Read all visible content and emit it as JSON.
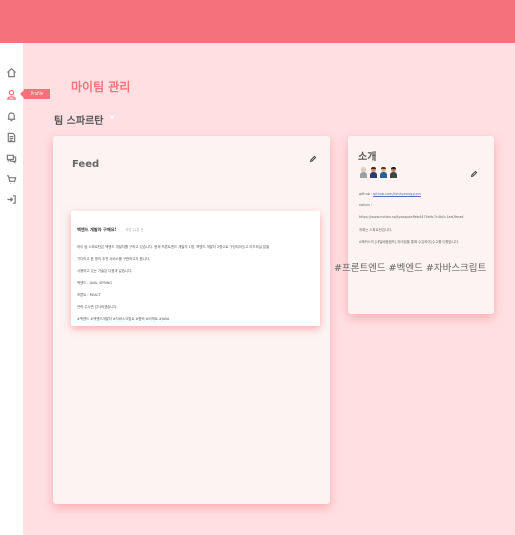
{
  "colors": {
    "accent": "#f6727b",
    "background": "#ffdfe2",
    "card": "#fdf3f3"
  },
  "sidebar": {
    "items": [
      {
        "icon": "home-icon"
      },
      {
        "icon": "user-icon",
        "tooltip": "Profile"
      },
      {
        "icon": "bell-icon"
      },
      {
        "icon": "document-icon"
      },
      {
        "icon": "chat-icon"
      },
      {
        "icon": "cart-icon"
      },
      {
        "icon": "logout-icon"
      }
    ]
  },
  "page": {
    "title": "마이팀 관리"
  },
  "team": {
    "name": "팀 스파르탄"
  },
  "feed": {
    "label": "Feed",
    "post": {
      "title": "백엔드 개발자 구해요!",
      "meta": "작성 12분 전",
      "lines": [
        "하이 팀 스파르탄은 백엔드 개발자를 구하고 있습니다. 현재 프론트엔드 개발자 1명, 백엔드 개발자 2명으로 구성되어있고 리드하실 분을",
        "기다리고 한 명의 추천 서비스를 구현하고자 합니다.",
        "사용하고 있는 기술은 다음과 같습니다.",
        "백엔드 : JAVA, SPRING",
        "프론트 : REACT",
        "연락 주시면 감사하겠습니다",
        "#백엔드 #백엔드개발자 #자바스크립트 #협력 #리액트 #JAVA"
      ]
    }
  },
  "intro": {
    "title": "소개",
    "github_prefix": "github : ",
    "github_link": "github.com/kimhyeongyunn",
    "notion_label": "notion :",
    "notion_url": "https://www.notion.so/tysoopaeffeb4474a9c7c4b0c1aa0fmad",
    "line1": "저희는 스파르탄입니다.",
    "line2": "A해커스의 [내일배움캠프] 마이팀을 통해 수강하여(수고를 다했습니다."
  },
  "hashtags": "#프론트엔드 #벡엔드 #자바스크립트"
}
